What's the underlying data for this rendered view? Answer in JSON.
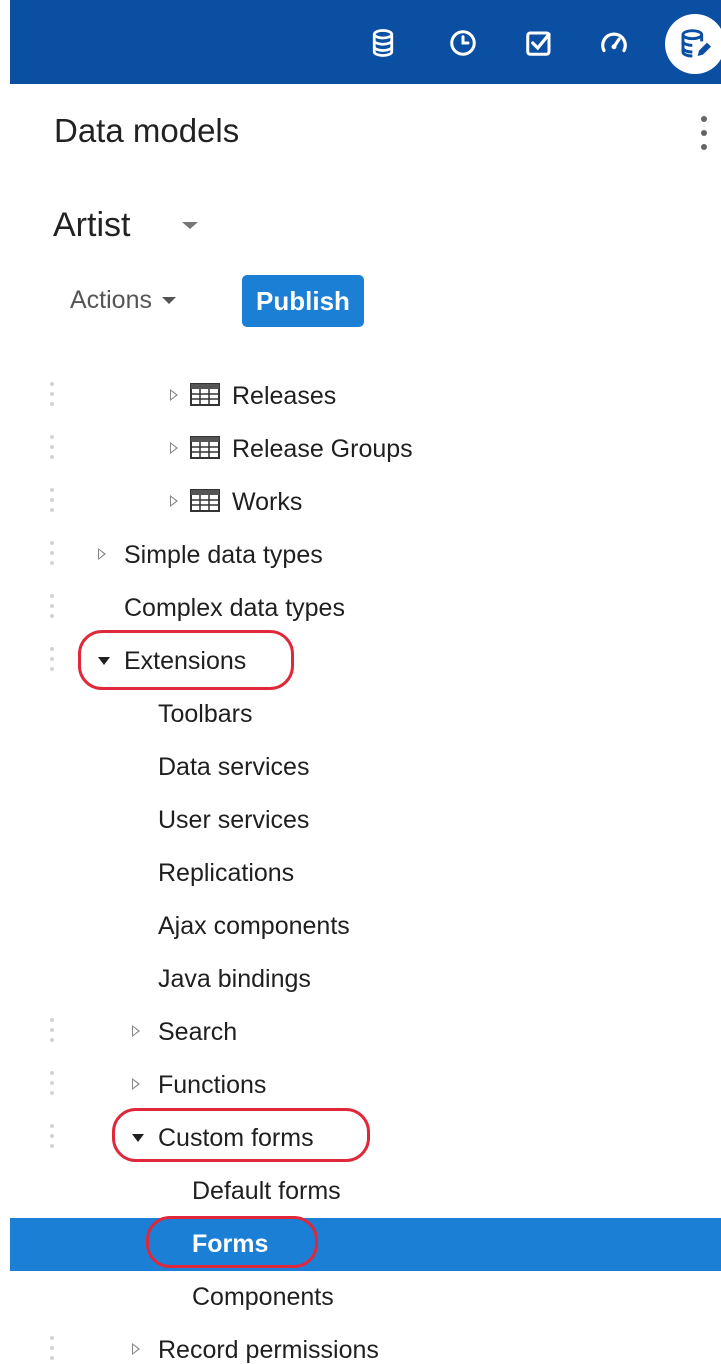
{
  "header": {
    "title": "Data models",
    "icons": [
      "database-icon",
      "history-clock-icon",
      "task-check-icon",
      "dashboard-gauge-icon",
      "data-model-edit-icon"
    ]
  },
  "model": {
    "name": "Artist"
  },
  "toolbar": {
    "actions_label": "Actions",
    "publish_label": "Publish"
  },
  "colors": {
    "topbar": "#0a4fa2",
    "accent": "#1b7fd6",
    "highlight": "#e0283a"
  },
  "tree": [
    {
      "label": "Releases",
      "indent": 3,
      "state": "collapsed",
      "icon": "table-icon",
      "handle": true,
      "selected": false
    },
    {
      "label": "Release Groups",
      "indent": 3,
      "state": "collapsed",
      "icon": "table-icon",
      "handle": true,
      "selected": false
    },
    {
      "label": "Works",
      "indent": 3,
      "state": "collapsed",
      "icon": "table-icon",
      "handle": true,
      "selected": false
    },
    {
      "label": "Simple data types",
      "indent": 1,
      "state": "collapsed",
      "icon": "",
      "handle": true,
      "selected": false
    },
    {
      "label": "Complex data types",
      "indent": 1,
      "state": "none",
      "icon": "",
      "handle": true,
      "selected": false
    },
    {
      "label": "Extensions",
      "indent": 1,
      "state": "expanded",
      "icon": "",
      "handle": true,
      "selected": false
    },
    {
      "label": "Toolbars",
      "indent": 2,
      "state": "none",
      "icon": "",
      "handle": false,
      "selected": false
    },
    {
      "label": "Data services",
      "indent": 2,
      "state": "none",
      "icon": "",
      "handle": false,
      "selected": false
    },
    {
      "label": "User services",
      "indent": 2,
      "state": "none",
      "icon": "",
      "handle": false,
      "selected": false
    },
    {
      "label": "Replications",
      "indent": 2,
      "state": "none",
      "icon": "",
      "handle": false,
      "selected": false
    },
    {
      "label": "Ajax components",
      "indent": 2,
      "state": "none",
      "icon": "",
      "handle": false,
      "selected": false
    },
    {
      "label": "Java bindings",
      "indent": 2,
      "state": "none",
      "icon": "",
      "handle": false,
      "selected": false
    },
    {
      "label": "Search",
      "indent": 2,
      "state": "collapsed",
      "icon": "",
      "handle": true,
      "selected": false
    },
    {
      "label": "Functions",
      "indent": 2,
      "state": "collapsed",
      "icon": "",
      "handle": true,
      "selected": false
    },
    {
      "label": "Custom forms",
      "indent": 2,
      "state": "expanded",
      "icon": "",
      "handle": true,
      "selected": false
    },
    {
      "label": "Default forms",
      "indent": 3,
      "state": "none",
      "icon": "",
      "handle": false,
      "selected": false
    },
    {
      "label": "Forms",
      "indent": 3,
      "state": "none",
      "icon": "",
      "handle": false,
      "selected": true
    },
    {
      "label": "Components",
      "indent": 3,
      "state": "none",
      "icon": "",
      "handle": false,
      "selected": false
    },
    {
      "label": "Record permissions",
      "indent": 2,
      "state": "collapsed",
      "icon": "",
      "handle": true,
      "selected": false
    }
  ],
  "annotations": [
    "Extensions",
    "Custom forms",
    "Forms"
  ]
}
